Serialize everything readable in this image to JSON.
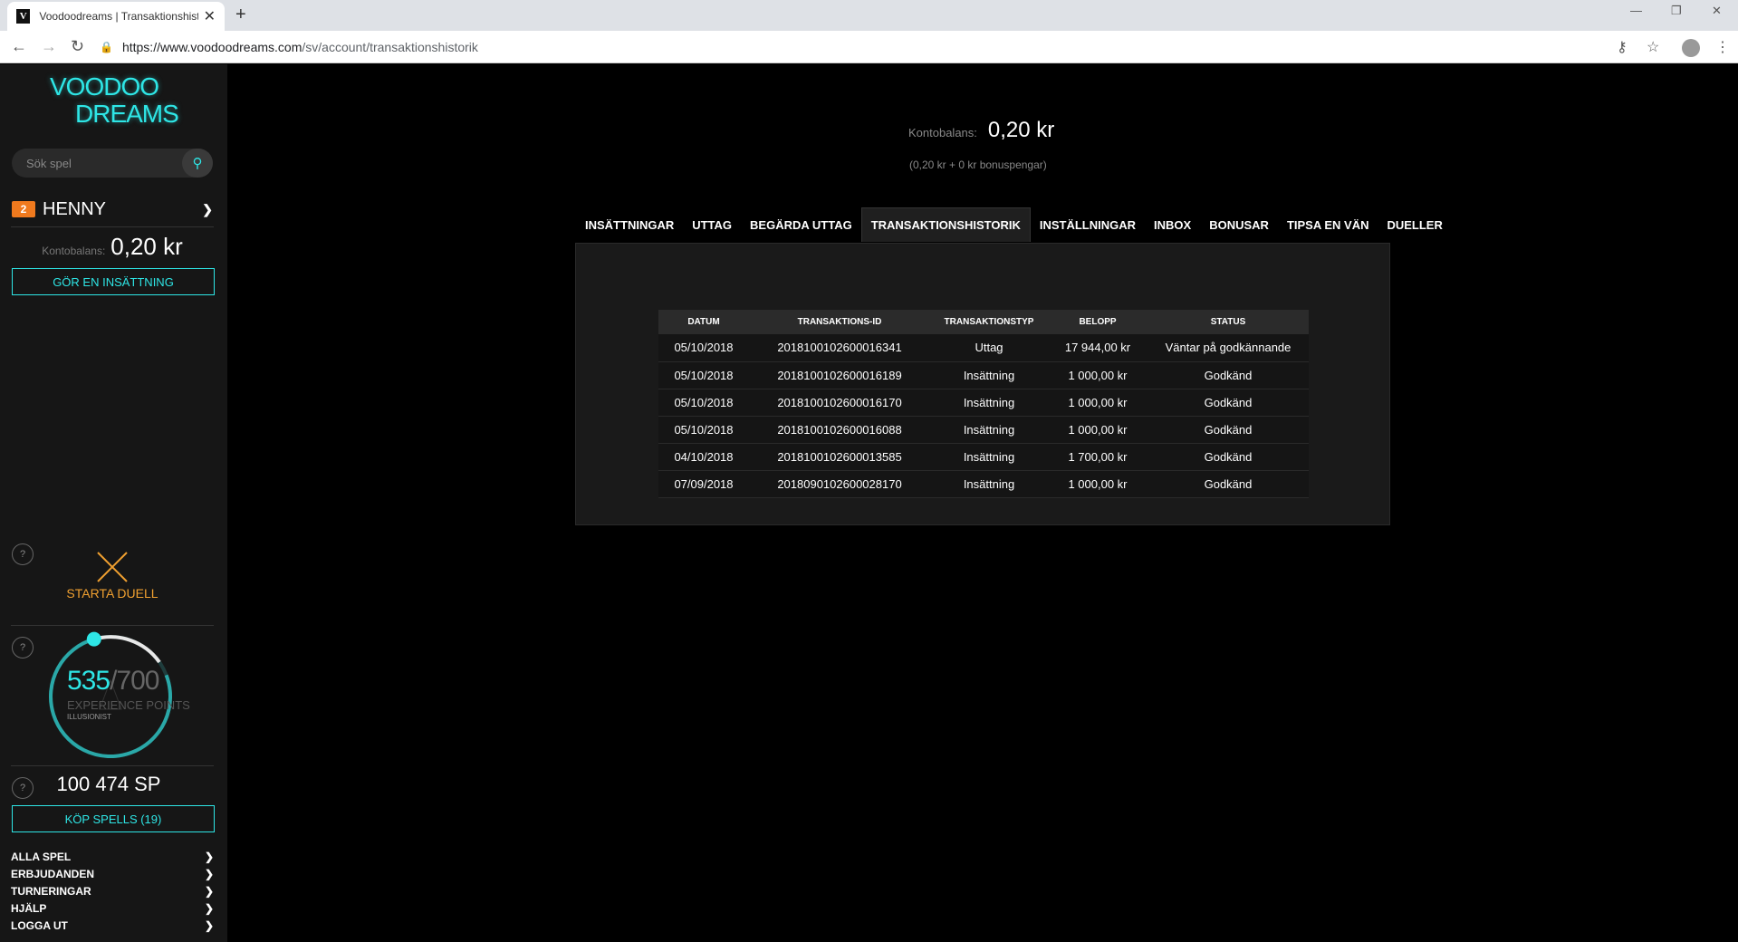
{
  "browser": {
    "tab_title": "Voodoodreams | Transaktionshistorik",
    "url_domain": "https://www.voodoodreams.com",
    "url_path": "/sv/account/transaktionshistorik"
  },
  "sidebar": {
    "logo_line1": "VOODOO",
    "logo_line2": "DREAMS",
    "search_placeholder": "Sök spel",
    "level": "2",
    "username": "HENNY",
    "balance_label": "Kontobalans:",
    "balance_value": "0,20 kr",
    "deposit_button": "GÖR EN INSÄTTNING",
    "duel_label": "STARTA DUELL",
    "xp_current": "535",
    "xp_max": "700",
    "xp_label": "EXPERIENCE POINTS",
    "xp_rank": "ILLUSIONIST",
    "xp_progress": 0.764,
    "sp_value": "100 474 SP",
    "buy_spells_button": "KÖP SPELLS (19)",
    "menu": [
      {
        "label": "ALLA SPEL"
      },
      {
        "label": "ERBJUDANDEN"
      },
      {
        "label": "TURNERINGAR"
      },
      {
        "label": "HJÄLP"
      },
      {
        "label": "LOGGA UT"
      }
    ],
    "accent_color": "#2ee6e6",
    "duel_color": "#f0a030"
  },
  "main": {
    "balance_label": "Kontobalans:",
    "balance_value": "0,20 kr",
    "bonus_line": "(0,20 kr + 0 kr bonuspengar)",
    "tabs": [
      {
        "label": "INSÄTTNINGAR"
      },
      {
        "label": "UTTAG"
      },
      {
        "label": "BEGÄRDA UTTAG"
      },
      {
        "label": "TRANSAKTIONSHISTORIK",
        "active": true
      },
      {
        "label": "INSTÄLLNINGAR"
      },
      {
        "label": "INBOX"
      },
      {
        "label": "BONUSAR"
      },
      {
        "label": "TIPSA EN VÄN"
      },
      {
        "label": "DUELLER"
      }
    ],
    "table": {
      "headers": [
        "DATUM",
        "TRANSAKTIONS-ID",
        "TRANSAKTIONSTYP",
        "BELOPP",
        "STATUS"
      ],
      "rows": [
        [
          "05/10/2018",
          "2018100102600016341",
          "Uttag",
          "17 944,00 kr",
          "Väntar på godkännande"
        ],
        [
          "05/10/2018",
          "2018100102600016189",
          "Insättning",
          "1 000,00 kr",
          "Godkänd"
        ],
        [
          "05/10/2018",
          "2018100102600016170",
          "Insättning",
          "1 000,00 kr",
          "Godkänd"
        ],
        [
          "05/10/2018",
          "2018100102600016088",
          "Insättning",
          "1 000,00 kr",
          "Godkänd"
        ],
        [
          "04/10/2018",
          "2018100102600013585",
          "Insättning",
          "1 700,00 kr",
          "Godkänd"
        ],
        [
          "07/09/2018",
          "2018090102600028170",
          "Insättning",
          "1 000,00 kr",
          "Godkänd"
        ]
      ]
    }
  }
}
